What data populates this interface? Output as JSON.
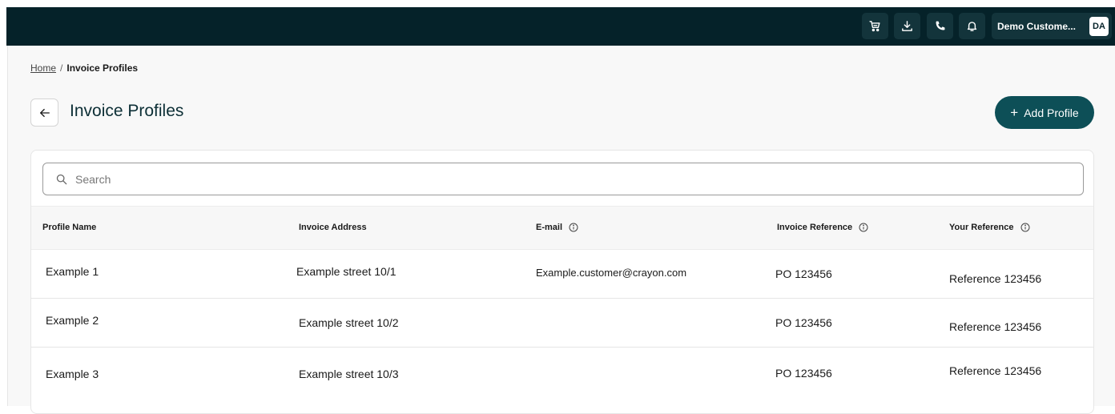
{
  "topbar": {
    "icons": [
      "cart-icon",
      "download-icon",
      "phone-icon",
      "bell-icon"
    ],
    "user_name": "Demo Custome...",
    "user_initials": "DA",
    "bg_color": "#052229"
  },
  "breadcrumb": {
    "home": "Home",
    "separator": "/",
    "current": "Invoice Profiles"
  },
  "page": {
    "title": "Invoice Profiles",
    "add_button": "Add Profile",
    "add_button_icon": "+",
    "accent_color": "#0d4f57"
  },
  "search": {
    "placeholder": "Search",
    "value": ""
  },
  "table": {
    "columns": [
      "Profile Name",
      "Invoice Address",
      "E-mail",
      "Invoice Reference",
      "Your Reference"
    ],
    "rows": [
      {
        "name": "Example 1",
        "address": "Example street 10/1",
        "email": "Example.customer@crayon.com",
        "invoice_ref": "PO 123456",
        "your_ref": "Reference 123456"
      },
      {
        "name": "Example 2",
        "address": "Example street 10/2",
        "email": "",
        "invoice_ref": "PO 123456",
        "your_ref": "Reference 123456"
      },
      {
        "name": "Example 3",
        "address": "Example street 10/3",
        "email": "",
        "invoice_ref": "PO 123456",
        "your_ref": "Reference 123456"
      }
    ]
  }
}
